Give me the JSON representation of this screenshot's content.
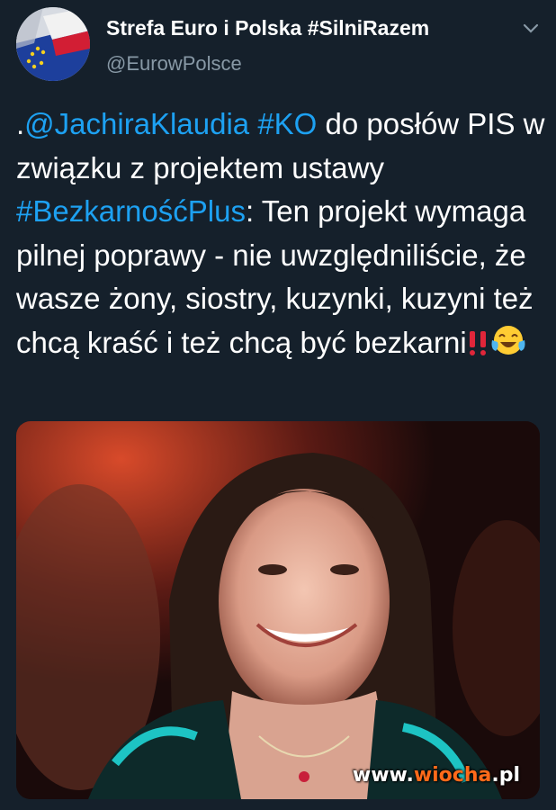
{
  "author": {
    "display_name": "Strefa Euro i Polska #SilniRazem",
    "handle": "@EurowPolsce"
  },
  "tweet": {
    "parts": [
      {
        "text": ".",
        "type": "text"
      },
      {
        "text": "@JachiraKlaudia",
        "type": "link"
      },
      {
        "text": " ",
        "type": "text"
      },
      {
        "text": "#KO",
        "type": "link"
      },
      {
        "text": " do posłów PIS w związku z projektem ustawy ",
        "type": "text"
      },
      {
        "text": "#BezkarnośćPlus",
        "type": "link"
      },
      {
        "text": ": Ten projekt wymaga pilnej poprawy - nie uwzględniliście, że wasze żony, siostry, kuzynki, kuzyni też chcą kraść i też chcą być bezkarni",
        "type": "text"
      }
    ],
    "emojis": [
      "double-exclamation",
      "tears-of-joy"
    ]
  },
  "watermark": {
    "prefix": "www.",
    "accent": "wiocha",
    "suffix": ".pl"
  },
  "colors": {
    "background": "#15202b",
    "link": "#1da1f2",
    "secondary_text": "#8899a6"
  },
  "icons": {
    "menu": "chevron-down-icon"
  }
}
